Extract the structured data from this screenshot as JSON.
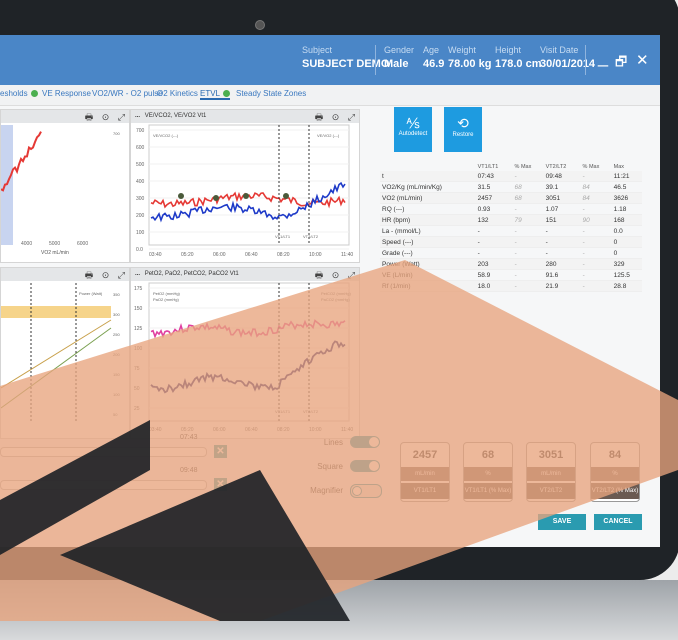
{
  "header": {
    "subject_label": "Subject",
    "subject_value": "SUBJECT DEMO",
    "gender_label": "Gender",
    "gender_value": "Male",
    "age_label": "Age",
    "age_value": "46.9",
    "weight_label": "Weight",
    "weight_value": "78.00 kg",
    "height_label": "Height",
    "height_value": "178.0 cm",
    "visit_label": "Visit Date",
    "visit_value": "30/01/2014",
    "minimize": "_",
    "restore": "🗗",
    "close": "✕"
  },
  "tabs": [
    {
      "label": "esholds",
      "check": true
    },
    {
      "label": "VE Response"
    },
    {
      "label": "VO2/WR - O2 pulse"
    },
    {
      "label": "O2 Kinetics"
    },
    {
      "label": "ETVL",
      "check": true,
      "active": true
    },
    {
      "label": "Steady State"
    },
    {
      "label": "Zones"
    }
  ],
  "panels": {
    "top_right_title": "VE/VCO2, VE/VO2 Vt1",
    "bottom_right_title": "PetO2, PaO2, PetCO2, PaCO2 Vt1",
    "top_right_legend_a": "VE/VCO2 (---)",
    "top_right_legend_b": "VE/VO2 (---)",
    "bottom_right_legend_a": "PetO2 (mmHg)",
    "bottom_right_legend_b": "PaO2 (mmHg)",
    "bottom_right_legend_c": "PetCO2 (mmHg)",
    "bottom_right_legend_d": "PaCO2 (mmHg)",
    "bottom_left_legend": "Power (Watt)",
    "marker_vt1": "VT1/LT1",
    "marker_vt2": "VT2/LT2",
    "x_ticks": [
      "03:40",
      "05:20",
      "06:00",
      "06:40",
      "08:20",
      "10:00",
      "11:40"
    ],
    "left_x_ticks": [
      "4000",
      "5000",
      "6000"
    ],
    "left_x_label": "VO2 mL/min",
    "top_y_ticks": [
      "700",
      "600",
      "500",
      "400",
      "300",
      "200",
      "100",
      "0.0"
    ],
    "bottom_y_ticks": [
      "175",
      "150",
      "125",
      "100",
      "75",
      "50",
      "25"
    ],
    "right_y_ticks": [
      "350",
      "300",
      "250",
      "200",
      "150",
      "100",
      "50"
    ],
    "etvl_label": "ETVL",
    "menu": "...",
    "print_icon": "🖶",
    "target_icon": "⊙",
    "expand_icon": "⤢"
  },
  "buttons": {
    "autodetect": "Autodetect",
    "restore": "Restore"
  },
  "table": {
    "headers": [
      "",
      "VT1/LT1",
      "% Max",
      "VT2/LT2",
      "% Max",
      "Max"
    ],
    "rows": [
      [
        "t",
        "07:43",
        "-",
        "09:48",
        "-",
        "11:21"
      ],
      [
        "VO2/Kg (mL/min/Kg)",
        "31.5",
        "68",
        "39.1",
        "84",
        "46.5"
      ],
      [
        "VO2 (mL/min)",
        "2457",
        "68",
        "3051",
        "84",
        "3626"
      ],
      [
        "RQ (---)",
        "0.93",
        "-",
        "1.07",
        "-",
        "1.18"
      ],
      [
        "HR (bpm)",
        "132",
        "79",
        "151",
        "90",
        "168"
      ],
      [
        "La - (mmol/L)",
        "-",
        "-",
        "-",
        "-",
        "0.0"
      ],
      [
        "Speed (---)",
        "-",
        "-",
        "-",
        "-",
        "0"
      ],
      [
        "Grade (---)",
        "-",
        "-",
        "-",
        "-",
        "0"
      ],
      [
        "Power (Watt)",
        "203",
        "-",
        "280",
        "-",
        "329"
      ],
      [
        "VE (L/min)",
        "58.9",
        "-",
        "91.6",
        "-",
        "125.5"
      ],
      [
        "Rf (1/min)",
        "18.0",
        "-",
        "21.9",
        "-",
        "28.8"
      ]
    ]
  },
  "sliders": {
    "top_value": "07:43",
    "bottom_value": "09:48"
  },
  "toggles": {
    "lines": "Lines",
    "square": "Square",
    "magnifier": "Magnifier"
  },
  "cards": [
    {
      "value": "2457",
      "unit": "mL/min",
      "name": "VT1/LT1"
    },
    {
      "value": "68",
      "unit": "%",
      "name": "VT1/LT1 (% Max)"
    },
    {
      "value": "3051",
      "unit": "mL/min",
      "name": "VT2/LT2"
    },
    {
      "value": "84",
      "unit": "%",
      "name": "VT2/LT2 (% Max)"
    }
  ],
  "actions": {
    "save": "SAVE",
    "cancel": "CANCEL"
  },
  "colors": {
    "header": "#4a86c7",
    "accent": "#1e9be0",
    "teal": "#2a9bb0",
    "overlay": "#e8a47e"
  }
}
